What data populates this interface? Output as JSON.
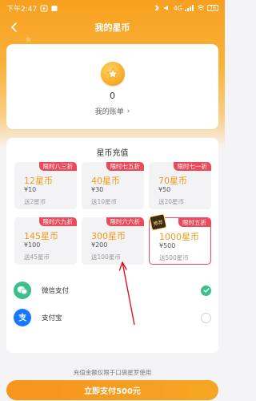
{
  "colors": {
    "accent": "#f6a623",
    "tag_red": "#ea4a5a",
    "amount_orange": "#f19a1a",
    "wechat_green": "#3cc08a",
    "alipay_blue": "#1677ff",
    "annotation_red": "#e60012"
  },
  "status_bar": {
    "time": "下午2:47",
    "battery": "76",
    "signal_text": "4G"
  },
  "navbar": {
    "back_icon": "chevron-left-icon",
    "title": "我的星币"
  },
  "account": {
    "coin_icon": "star-coin-icon",
    "balance": "0",
    "bill_link": "我的账单",
    "bill_arrow": "›"
  },
  "recharge": {
    "title": "星币充值",
    "hot_badge": "推荐",
    "packages": [
      {
        "tag": "限时八三折",
        "amount": "12星币",
        "price": "¥10",
        "bonus": "送2星币",
        "selected": false
      },
      {
        "tag": "限时七五折",
        "amount": "40星币",
        "price": "¥30",
        "bonus": "送10星币",
        "selected": false
      },
      {
        "tag": "限时七一折",
        "amount": "70星币",
        "price": "¥50",
        "bonus": "送20星币",
        "selected": false
      },
      {
        "tag": "限时六九折",
        "amount": "145星币",
        "price": "¥100",
        "bonus": "送45星币",
        "selected": false
      },
      {
        "tag": "限时六六折",
        "amount": "300星币",
        "price": "¥200",
        "bonus": "送100星币",
        "selected": false
      },
      {
        "tag": "限时五折",
        "amount": "1000星币",
        "price": "¥500",
        "bonus": "送500星币",
        "selected": true
      }
    ]
  },
  "payment": {
    "methods": [
      {
        "label": "微信支付",
        "icon": "wechat-icon",
        "checked": true
      },
      {
        "label": "支付宝",
        "icon": "alipay-icon",
        "checked": false
      }
    ]
  },
  "footer": {
    "notice": "充值金额仅限于口袋星罗使用",
    "pay_button": "立即支付500元"
  }
}
